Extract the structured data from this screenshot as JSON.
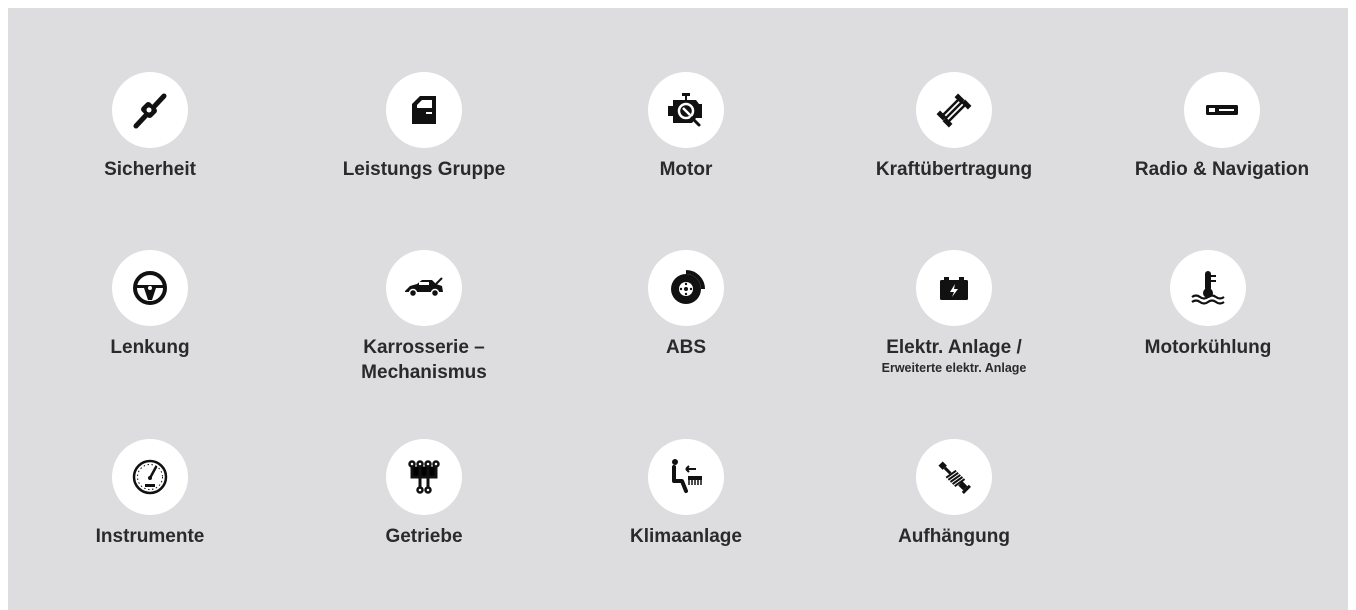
{
  "categories": [
    {
      "id": "sicherheit",
      "label": "Sicherheit",
      "icon": "seatbelt-icon"
    },
    {
      "id": "leistungs-gruppe",
      "label": "Leistungs Gruppe",
      "icon": "car-door-icon"
    },
    {
      "id": "motor",
      "label": "Motor",
      "icon": "engine-wrench-icon"
    },
    {
      "id": "kraftuebertragung",
      "label": "Kraftübertragung",
      "icon": "drivetrain-icon"
    },
    {
      "id": "radio-navigation",
      "label": "Radio & Navigation",
      "icon": "radio-icon"
    },
    {
      "id": "lenkung",
      "label": "Lenkung",
      "icon": "steering-wheel-icon"
    },
    {
      "id": "karrosserie",
      "label": "Karrosserie –",
      "label2": "Mechanismus",
      "icon": "car-body-icon"
    },
    {
      "id": "abs",
      "label": "ABS",
      "icon": "brake-disc-icon"
    },
    {
      "id": "elektr-anlage",
      "label": "Elektr. Anlage /",
      "sublabel": "Erweiterte elektr. Anlage",
      "icon": "battery-icon"
    },
    {
      "id": "motorkuehlung",
      "label": "Motorkühlung",
      "icon": "coolant-temperature-icon"
    },
    {
      "id": "instrumente",
      "label": "Instrumente",
      "icon": "speedometer-icon"
    },
    {
      "id": "getriebe",
      "label": "Getriebe",
      "icon": "gear-shift-icon"
    },
    {
      "id": "klimaanlage",
      "label": "Klimaanlage",
      "icon": "climate-control-icon"
    },
    {
      "id": "aufhaengung",
      "label": "Aufhängung",
      "icon": "shock-absorber-icon"
    }
  ],
  "colors": {
    "panel": "#dddde0",
    "circle": "#ffffff",
    "text": "#2a2a2a",
    "icon": "#111111"
  }
}
